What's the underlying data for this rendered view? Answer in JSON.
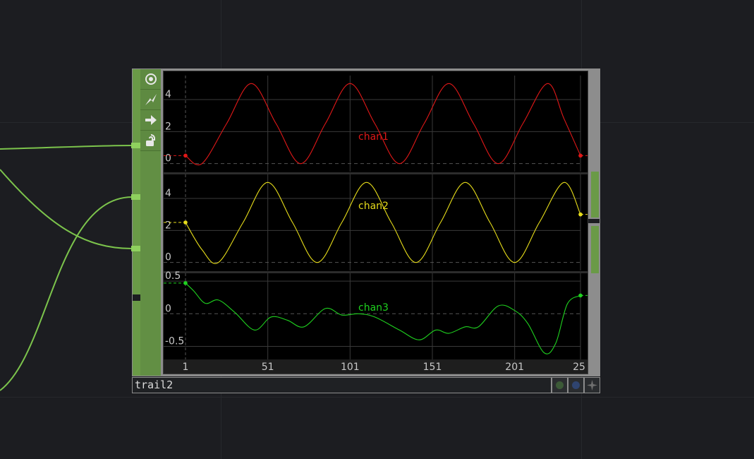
{
  "operator": {
    "name": "trail2",
    "type": "trail-chop",
    "icons": [
      "viewer-icon",
      "cook-icon",
      "export-icon",
      "lock-icon"
    ],
    "flag_colors": [
      "#3c5a37",
      "#2f4470",
      "#6f6f6f"
    ]
  },
  "colors": {
    "node": "#6a9a47",
    "wire": "#7cc44c",
    "background": "#1c1d21"
  },
  "chart_data": {
    "type": "line",
    "x_ticks": [
      "1",
      "51",
      "101",
      "151",
      "201",
      "25"
    ],
    "xlim": [
      1,
      241
    ],
    "panels": [
      {
        "name": "chan1",
        "color": "#e01818",
        "ylim": [
          -0.5,
          5.5
        ],
        "y_ticks": [
          "4",
          "2",
          "0"
        ],
        "y_tick_values": [
          4,
          2,
          0
        ],
        "series": {
          "name": "chan1",
          "start": [
            1,
            0.5
          ],
          "end": [
            241,
            0.5
          ],
          "points": [
            [
              1,
              0.5
            ],
            [
              11,
              0
            ],
            [
              26,
              2.5
            ],
            [
              41,
              5
            ],
            [
              56,
              2.5
            ],
            [
              71,
              0
            ],
            [
              86,
              2.5
            ],
            [
              101,
              5
            ],
            [
              116,
              2.5
            ],
            [
              131,
              0
            ],
            [
              146,
              2.5
            ],
            [
              161,
              5
            ],
            [
              176,
              2.5
            ],
            [
              191,
              0
            ],
            [
              206,
              2.5
            ],
            [
              221,
              5
            ],
            [
              231,
              2.8
            ],
            [
              241,
              0.5
            ]
          ]
        }
      },
      {
        "name": "chan2",
        "color": "#e6dc1a",
        "ylim": [
          -0.5,
          5.5
        ],
        "y_ticks": [
          "4",
          "2",
          "0"
        ],
        "y_tick_values": [
          4,
          2,
          0
        ],
        "series": {
          "name": "chan2",
          "start": [
            1,
            2.5
          ],
          "end": [
            241,
            3
          ],
          "points": [
            [
              1,
              2.5
            ],
            [
              11,
              0.8
            ],
            [
              21,
              0
            ],
            [
              36,
              2.5
            ],
            [
              51,
              5
            ],
            [
              66,
              2.5
            ],
            [
              81,
              0
            ],
            [
              96,
              2.5
            ],
            [
              111,
              5
            ],
            [
              126,
              2.5
            ],
            [
              141,
              0
            ],
            [
              156,
              2.5
            ],
            [
              171,
              5
            ],
            [
              186,
              2.5
            ],
            [
              201,
              0
            ],
            [
              216,
              2.5
            ],
            [
              231,
              5
            ],
            [
              241,
              3
            ]
          ]
        }
      },
      {
        "name": "chan3",
        "color": "#1fd21f",
        "ylim": [
          -0.7,
          0.62
        ],
        "y_ticks": [
          "0.5",
          "0",
          "-0.5"
        ],
        "y_tick_values": [
          0.5,
          0,
          -0.5
        ],
        "series": {
          "name": "chan3",
          "start": [
            1,
            0.47
          ],
          "end": [
            241,
            0.28
          ],
          "points": [
            [
              1,
              0.47
            ],
            [
              6,
              0.35
            ],
            [
              13,
              0.16
            ],
            [
              21,
              0.21
            ],
            [
              31,
              0.02
            ],
            [
              43,
              -0.25
            ],
            [
              53,
              -0.05
            ],
            [
              63,
              -0.1
            ],
            [
              73,
              -0.2
            ],
            [
              86,
              0.08
            ],
            [
              96,
              -0.02
            ],
            [
              106,
              0
            ],
            [
              116,
              -0.05
            ],
            [
              131,
              -0.25
            ],
            [
              143,
              -0.4
            ],
            [
              153,
              -0.25
            ],
            [
              161,
              -0.3
            ],
            [
              171,
              -0.2
            ],
            [
              179,
              -0.2
            ],
            [
              191,
              0.12
            ],
            [
              201,
              0.05
            ],
            [
              209,
              -0.15
            ],
            [
              219,
              -0.6
            ],
            [
              226,
              -0.45
            ],
            [
              233,
              0.15
            ],
            [
              241,
              0.28
            ]
          ]
        }
      }
    ]
  }
}
